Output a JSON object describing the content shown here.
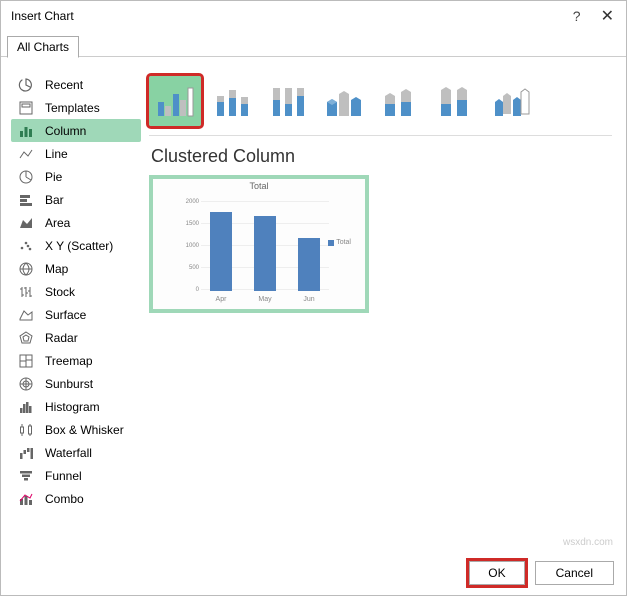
{
  "dialog": {
    "title": "Insert Chart"
  },
  "tabs": {
    "all_charts": "All Charts"
  },
  "sidebar": {
    "items": [
      {
        "label": "Recent"
      },
      {
        "label": "Templates"
      },
      {
        "label": "Column"
      },
      {
        "label": "Line"
      },
      {
        "label": "Pie"
      },
      {
        "label": "Bar"
      },
      {
        "label": "Area"
      },
      {
        "label": "X Y (Scatter)"
      },
      {
        "label": "Map"
      },
      {
        "label": "Stock"
      },
      {
        "label": "Surface"
      },
      {
        "label": "Radar"
      },
      {
        "label": "Treemap"
      },
      {
        "label": "Sunburst"
      },
      {
        "label": "Histogram"
      },
      {
        "label": "Box & Whisker"
      },
      {
        "label": "Waterfall"
      },
      {
        "label": "Funnel"
      },
      {
        "label": "Combo"
      }
    ]
  },
  "subtypes": {
    "names": [
      "clustered-column",
      "stacked-column",
      "100-stacked-column",
      "3d-clustered-column",
      "3d-stacked-column",
      "3d-100-stacked-column",
      "3d-column"
    ]
  },
  "main": {
    "chart_type_title": "Clustered Column"
  },
  "chart_data": {
    "type": "bar",
    "title": "Total",
    "categories": [
      "Apr",
      "May",
      "Jun"
    ],
    "values": [
      1800,
      1700,
      1200
    ],
    "y_ticks": [
      0,
      500,
      1000,
      1500,
      2000
    ],
    "ylabel": "",
    "xlabel": "",
    "ylim": [
      0,
      2000
    ],
    "legend": {
      "entries": [
        "Total"
      ],
      "position": "right"
    }
  },
  "footer": {
    "ok": "OK",
    "cancel": "Cancel"
  },
  "watermark": "wsxdn.com"
}
